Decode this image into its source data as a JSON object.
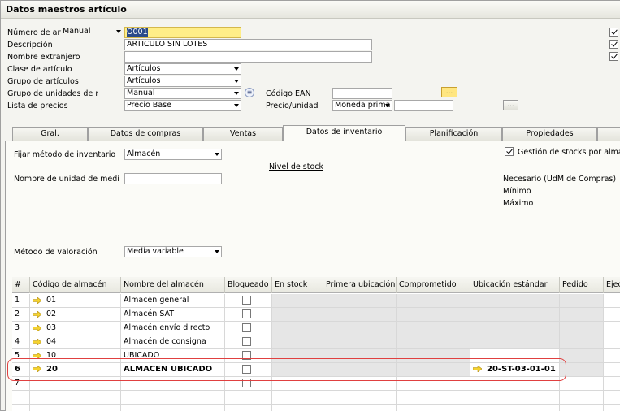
{
  "window": {
    "title": "Datos maestros artículo"
  },
  "header": {
    "numero": {
      "label": "Número de art",
      "series": "Manual",
      "value": "O001"
    },
    "descripcion": {
      "label": "Descripción",
      "value": "ARTICULO SIN LOTES"
    },
    "nombre_extranjero": {
      "label": "Nombre extranjero",
      "value": ""
    },
    "clase": {
      "label": "Clase de artículo",
      "value": "Artículos"
    },
    "grupo": {
      "label": "Grupo de artículos",
      "value": "Artículos"
    },
    "grupo_unidades": {
      "label": "Grupo de unidades de m",
      "value": "Manual"
    },
    "lista_precios": {
      "label": "Lista de precios",
      "value": "Precio Base"
    },
    "codigo_ean": {
      "label": "Código EAN",
      "value": ""
    },
    "precio_unidad": {
      "label": "Precio/unidad",
      "currency": "Moneda prima",
      "value": ""
    },
    "ellipsis": "...",
    "info_glyph": "≡",
    "checkboxes": [
      true,
      true,
      true
    ]
  },
  "tabs": [
    {
      "label": "Gral."
    },
    {
      "label": "Datos de compras"
    },
    {
      "label": "Ventas"
    },
    {
      "label": "Datos de inventario",
      "active": true
    },
    {
      "label": "Planificación"
    },
    {
      "label": "Propiedades"
    }
  ],
  "inventory": {
    "fijar_metodo": {
      "label": "Fijar método de inventario",
      "value": "Almacén"
    },
    "nivel_stock_link": "Nivel de stock",
    "nombre_unidad": {
      "label": "Nombre de unidad de medi",
      "value": ""
    },
    "gestion_stocks": {
      "label": "Gestión de stocks por almace",
      "checked": true
    },
    "necesario": "Necesario (UdM de Compras)",
    "minimo": "Mínimo",
    "maximo": "Máximo",
    "metodo_valoracion": {
      "label": "Método de valoración",
      "value": "Media variable"
    }
  },
  "grid": {
    "columns": [
      "#",
      "Código de almacén",
      "Nombre del almacén",
      "Bloqueado",
      "En stock",
      "Primera ubicación",
      "Comprometido",
      "Ubicación estándar",
      "Pedido",
      "Ejec"
    ],
    "rows": [
      {
        "num": "1",
        "code": "01",
        "name": "Almacén general",
        "bin": ""
      },
      {
        "num": "2",
        "code": "02",
        "name": "Almacén SAT",
        "bin": ""
      },
      {
        "num": "3",
        "code": "03",
        "name": "Almacén envío directo",
        "bin": ""
      },
      {
        "num": "4",
        "code": "04",
        "name": "Almacén de consigna",
        "bin": ""
      },
      {
        "num": "5",
        "code": "10",
        "name": "UBICADO",
        "bin": ""
      },
      {
        "num": "6",
        "code": "20",
        "name": "ALMACEN UBICADO",
        "bin": "20-ST-03-01-01"
      },
      {
        "num": "7",
        "code": "",
        "name": "",
        "bin": ""
      }
    ]
  }
}
